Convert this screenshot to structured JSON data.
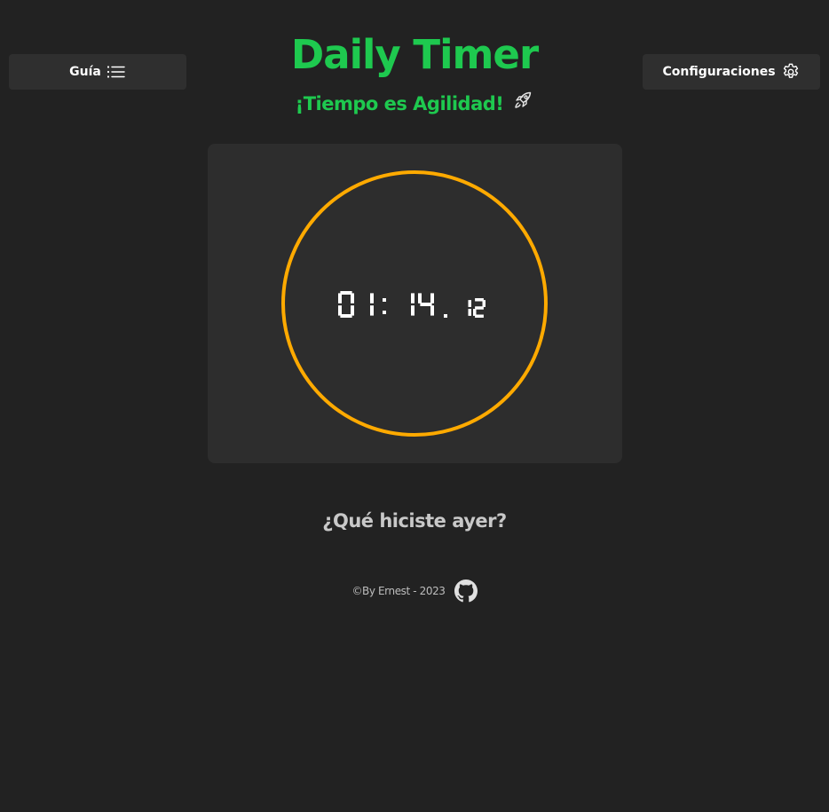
{
  "header": {
    "guide_button_label": "Guía",
    "guide_icon": "list-icon",
    "config_button_label": "Configuraciones",
    "config_icon": "gear-icon",
    "title": "Daily Timer",
    "subtitle": "¡Tiempo es Agilidad!",
    "subtitle_icon": "rocket-icon"
  },
  "timer": {
    "display": "01:14.12",
    "minutes": "01",
    "seconds": "14",
    "hundredths": "12",
    "ring_progress": 1.0,
    "ring_color": "#ffaa00"
  },
  "prompt": {
    "question": "¿Qué hiciste ayer?"
  },
  "footer": {
    "credit": "©By Ernest - 2023",
    "link_icon": "github-icon"
  },
  "colors": {
    "background": "#222222",
    "card": "#2d2d2d",
    "button": "#2f2f2f",
    "accent_green": "#1ec94f",
    "ring_orange": "#ffaa00",
    "digits": "#ffffff"
  }
}
